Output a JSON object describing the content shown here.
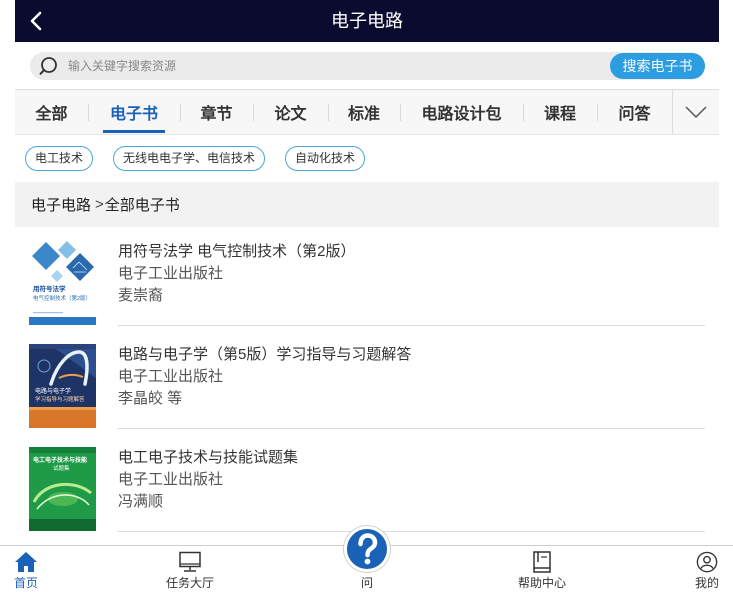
{
  "app": {
    "title": "电子电路"
  },
  "search": {
    "placeholder": "输入关键字搜索资源",
    "button_label": "搜索电子书"
  },
  "tabs": {
    "items": [
      {
        "label": "全部",
        "active": false
      },
      {
        "label": "电子书",
        "active": true
      },
      {
        "label": "章节",
        "active": false
      },
      {
        "label": "论文",
        "active": false
      },
      {
        "label": "标准",
        "active": false
      },
      {
        "label": "电路设计包",
        "active": false
      },
      {
        "label": "课程",
        "active": false
      },
      {
        "label": "问答",
        "active": false
      }
    ]
  },
  "tags": [
    "电工技术",
    "无线电电子学、电信技术",
    "自动化技术"
  ],
  "breadcrumb": {
    "root": "电子电路",
    "separator": ">",
    "current": "全部电子书"
  },
  "books": [
    {
      "title": "用符号法学 电气控制技术（第2版）",
      "publisher": "电子工业出版社",
      "author": "麦崇裔",
      "cover_text": [
        "用符号法学",
        "电气控制技术（第2版）"
      ]
    },
    {
      "title": "电路与电子学（第5版）学习指导与习题解答",
      "publisher": "电子工业出版社",
      "author": "李晶皎 等",
      "cover_text": [
        "电路与电子学",
        "学习指导与习题解答"
      ]
    },
    {
      "title": "电工电子技术与技能试题集",
      "publisher": "电子工业出版社",
      "author": "冯满顺",
      "cover_text": [
        "电工电子技术与技能",
        "试题集"
      ]
    }
  ],
  "bottom_nav": {
    "items": [
      {
        "label": "首页",
        "icon": "home-icon",
        "active": true
      },
      {
        "label": "任务大厅",
        "icon": "monitor-icon",
        "active": false
      },
      {
        "label": "问",
        "icon": "question-icon",
        "active": false
      },
      {
        "label": "帮助中心",
        "icon": "book-icon",
        "active": false
      },
      {
        "label": "我的",
        "icon": "user-icon",
        "active": false
      }
    ]
  },
  "icons": {
    "back": "chevron-left-icon",
    "search": "search-icon",
    "tabs_more": "chevron-down-icon"
  },
  "colors": {
    "header_bg": "#0b0b30",
    "accent": "#1a62b8",
    "search_button": "#2b9de0",
    "tag_border": "#4aa6d8",
    "panel_bg": "#f2f2f2"
  }
}
